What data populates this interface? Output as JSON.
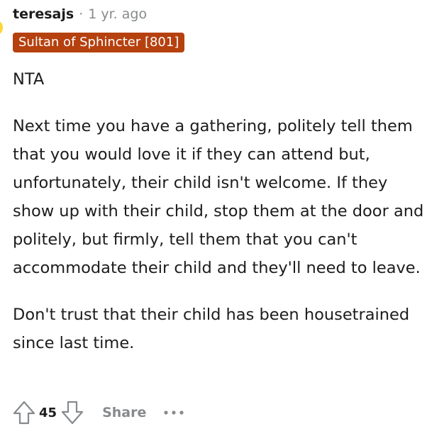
{
  "comment": {
    "username": "teresajs",
    "separator": "·",
    "timestamp": "1 yr. ago",
    "flair": "Sultan of Sphincter [801]",
    "paragraphs": [
      "NTA",
      "Next time you have a gathering, politely tell them that you would love it if they can attend but, unfortunately, their child isn't welcome. If they show up with their child, stop them at the door and politely, but firmly, tell them that you can't accommodate their child and they'll need to leave.",
      "Don't trust that their child has been housetrained since last time."
    ]
  },
  "actions": {
    "upvote_icon": "upvote-arrow-icon",
    "score": "45",
    "downvote_icon": "downvote-arrow-icon",
    "share_label": "Share",
    "more_icon": "more-options-icon"
  },
  "colors": {
    "flair_background": "#b5410f",
    "muted_text": "#878a8c",
    "avatar_accent": "#ffd635"
  }
}
